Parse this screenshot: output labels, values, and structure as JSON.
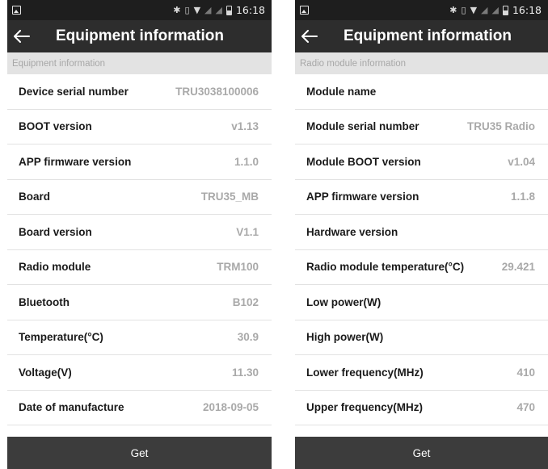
{
  "left_screen": {
    "status_bar": {
      "time": "16:18"
    },
    "app_bar": {
      "title": "Equipment information"
    },
    "section_header": "Equipment information",
    "rows": [
      {
        "label": "Device serial number",
        "value": "TRU3038100006"
      },
      {
        "label": "BOOT version",
        "value": "v1.13"
      },
      {
        "label": "APP firmware version",
        "value": "1.1.0"
      },
      {
        "label": "Board",
        "value": "TRU35_MB"
      },
      {
        "label": "Board version",
        "value": "V1.1"
      },
      {
        "label": "Radio module",
        "value": "TRM100"
      },
      {
        "label": "Bluetooth",
        "value": "B102"
      },
      {
        "label": "Temperature(°C)",
        "value": "30.9"
      },
      {
        "label": "Voltage(V)",
        "value": "11.30"
      },
      {
        "label": "Date of manufacture",
        "value": "2018-09-05"
      }
    ],
    "get_label": "Get"
  },
  "right_screen": {
    "status_bar": {
      "time": "16:18"
    },
    "app_bar": {
      "title": "Equipment information"
    },
    "section_header": "Radio module information",
    "rows": [
      {
        "label": "Module name",
        "value": ""
      },
      {
        "label": "Module serial number",
        "value": "TRU35 Radio"
      },
      {
        "label": "Module BOOT version",
        "value": "v1.04"
      },
      {
        "label": "APP firmware version",
        "value": "1.1.8"
      },
      {
        "label": "Hardware version",
        "value": ""
      },
      {
        "label": "Radio module temperature(°C)",
        "value": "29.421"
      },
      {
        "label": "Low power(W)",
        "value": ""
      },
      {
        "label": "High power(W)",
        "value": ""
      },
      {
        "label": "Lower frequency(MHz)",
        "value": "410"
      },
      {
        "label": "Upper frequency(MHz)",
        "value": "470"
      }
    ],
    "get_label": "Get"
  },
  "colors": {
    "status_bar": "#1e1e1e",
    "app_bar": "#2d2d2d",
    "section_header_bg": "#e3e3e3",
    "value_text": "#a9a9a9",
    "get_bar": "#3c3c3c"
  },
  "icons": {
    "back": "arrow-left-icon",
    "notification": "image-icon",
    "bluetooth": "bluetooth-icon",
    "vibrate": "vibrate-icon",
    "wifi": "wifi-icon",
    "signal": "signal-icon",
    "battery": "battery-icon"
  }
}
